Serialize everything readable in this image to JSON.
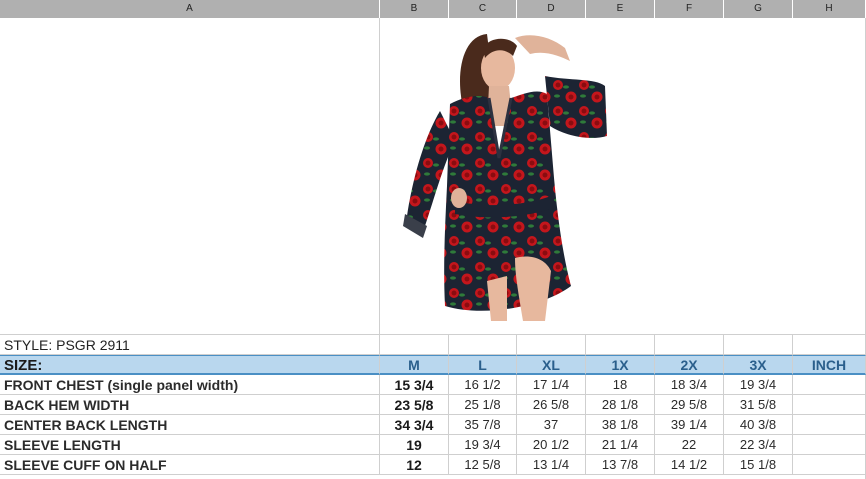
{
  "columns": [
    "A",
    "B",
    "C",
    "D",
    "E",
    "F",
    "G",
    "H"
  ],
  "style_line": "STYLE: PSGR 2911",
  "size_header": {
    "label": "SIZE:",
    "sizes": [
      "M",
      "L",
      "XL",
      "1X",
      "2X",
      "3X",
      "INCH"
    ]
  },
  "rows": [
    {
      "label": "FRONT CHEST (single panel width)",
      "values": [
        "15 3/4",
        "16 1/2",
        "17 1/4",
        "18",
        "18 3/4",
        "19 3/4",
        ""
      ]
    },
    {
      "label": "BACK HEM WIDTH",
      "values": [
        "23 5/8",
        "25 1/8",
        "26 5/8",
        "28 1/8",
        "29 5/8",
        "31 5/8",
        ""
      ]
    },
    {
      "label": "CENTER BACK LENGTH",
      "values": [
        "34 3/4",
        "35 7/8",
        "37",
        "38 1/8",
        "39 1/4",
        "40 3/8",
        ""
      ]
    },
    {
      "label": "SLEEVE LENGTH",
      "values": [
        "19",
        "19 3/4",
        "20 1/2",
        "21 1/4",
        "22",
        "22 3/4",
        ""
      ]
    },
    {
      "label": "SLEEVE CUFF ON HALF",
      "values": [
        "12",
        "12 5/8",
        "13 1/4",
        "13 7/8",
        "14 1/2",
        "15 1/8",
        ""
      ]
    }
  ],
  "colors": {
    "header_bar": "#b0b0b0",
    "size_row_fill": "#b9d7ee",
    "size_text": "#2a5f8c",
    "robe_base": "#1c2433",
    "rose": "#c4161c",
    "leaf": "#2f7a3a"
  }
}
